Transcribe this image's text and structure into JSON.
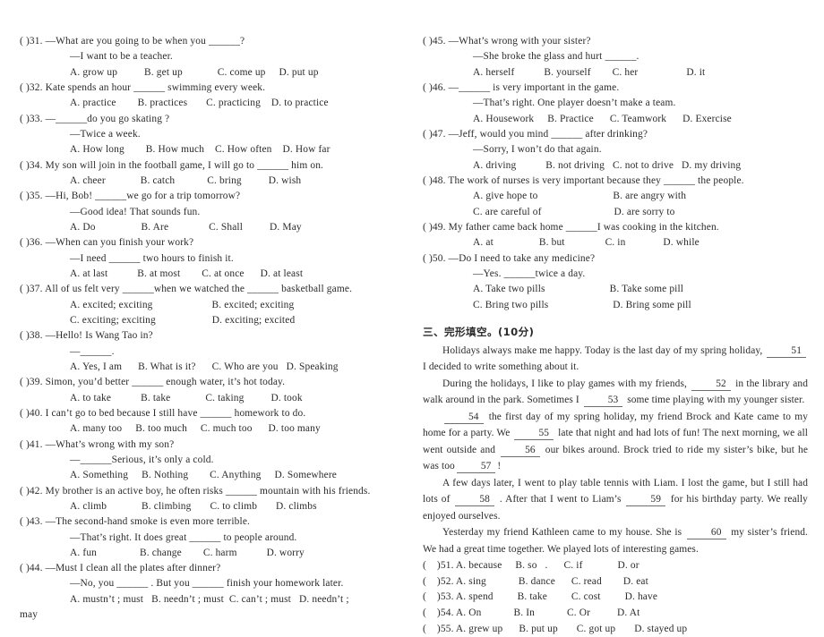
{
  "document": {
    "type": "english-exam-paper",
    "background_color": "#ffffff",
    "text_color": "#2b2b2b"
  },
  "left_column": {
    "questions": [
      {
        "marker": "(    )31.",
        "stem": "—What are you going to be when you ______?",
        "reply": "—I want to be a teacher.",
        "options_lines": [
          "A. grow up          B. get up             C. come up     D. put up"
        ]
      },
      {
        "marker": "(    )32.",
        "stem": "Kate spends an hour ______ swimming every week.",
        "reply": "",
        "options_lines": [
          "A. practice        B. practices       C. practicing    D. to practice"
        ]
      },
      {
        "marker": "(    )33.",
        "stem": "—______do you go skating ?",
        "reply": "—Twice a week.",
        "options_lines": [
          "A. How long        B. How much    C. How often    D. How far"
        ]
      },
      {
        "marker": "(    )34.",
        "stem": "My son will join in the football game, I will go to ______ him  on.",
        "reply": "",
        "options_lines": [
          "A. cheer             B. catch            C. bring          D. wish"
        ]
      },
      {
        "marker": "(    )35.",
        "stem": "—Hi, Bob! ______we go for a trip tomorrow?",
        "reply": "—Good idea! That sounds fun.",
        "options_lines": [
          "A. Do                 B. Are               C. Shall          D. May"
        ]
      },
      {
        "marker": "(    )36.",
        "stem": "—When can you finish your work?",
        "reply": "—I need ______ two hours to finish it.",
        "options_lines": [
          "A. at last           B. at most        C. at once      D. at least"
        ]
      },
      {
        "marker": "(    )37.",
        "stem": "All of us felt very ______when we watched the ______ basketball game.",
        "reply": "",
        "options_lines": [
          "A. excited; exciting                      B. excited; exciting",
          "C. exciting; exciting                     D. exciting; excited"
        ]
      },
      {
        "marker": "(    )38.",
        "stem": "—Hello! Is Wang Tao in?",
        "reply": "—______.",
        "options_lines": [
          "A. Yes, I am      B. What is it?      C. Who are you   D. Speaking"
        ]
      },
      {
        "marker": "(    )39.",
        "stem": "Simon, you’d better ______ enough water, it’s hot today.",
        "reply": "",
        "options_lines": [
          "A. to take           B. take             C. taking          D. took"
        ]
      },
      {
        "marker": "(    )40.",
        "stem": "I can’t go to bed because I still have ______ homework to do.",
        "reply": "",
        "options_lines": [
          "A. many too     B. too much     C. much too      D. too many"
        ]
      },
      {
        "marker": "(    )41.",
        "stem": "—What’s wrong with my son?",
        "reply": "—______Serious, it’s only a cold.",
        "options_lines": [
          "A. Something     B. Nothing        C. Anything     D. Somewhere"
        ]
      },
      {
        "marker": "(    )42.",
        "stem": "My brother is an active boy, he often risks ______ mountain with his friends.",
        "reply": "",
        "options_lines": [
          "A. climb             B. climbing       C. to climb       D. climbs"
        ]
      },
      {
        "marker": "(    )43.",
        "stem": "—The second-hand smoke is even more terrible.",
        "reply": "—That’s right. It does great ______ to people around.",
        "options_lines": [
          "A. fun                B. change        C. harm           D. worry"
        ]
      },
      {
        "marker": "(    )44.",
        "stem": "—Must I clean all the plates after dinner?",
        "reply": "—No, you ______ . But you ______ finish your homework later.",
        "options_lines": [
          "A. mustn’t ; must   B. needn’t ; must  C. can’t ; must   D. needn’t ;"
        ],
        "overflow": "may"
      }
    ]
  },
  "right_column": {
    "questions": [
      {
        "marker": "(    )45.",
        "stem": "—What’s wrong with your sister?",
        "reply": "—She broke the glass and hurt ______.",
        "options_lines": [
          "A. herself           B. yourself        C. her                  D. it"
        ]
      },
      {
        "marker": "(    )46.",
        "stem": "—______ is very important in the game.",
        "reply": "—That’s right. One player doesn’t make a team.",
        "options_lines": [
          "A. Housework     B. Practice      C. Teamwork      D. Exercise"
        ]
      },
      {
        "marker": "(    )47.",
        "stem": "—Jeff, would you mind ______ after drinking?",
        "reply": "—Sorry, I won’t do that again.",
        "options_lines": [
          "A. driving           B. not driving   C. not to drive   D. my driving"
        ]
      },
      {
        "marker": "(    )48.",
        "stem": "The work of nurses is very important because they ______ the people.",
        "reply": "",
        "options_lines": [
          "A. give hope to                            B. are angry with",
          "C. are careful of                           D. are sorry to"
        ]
      },
      {
        "marker": "(    )49.",
        "stem": "My father came back home ______I was cooking in the kitchen.",
        "reply": "",
        "options_lines": [
          "A. at                 B. but               C. in              D. while"
        ]
      },
      {
        "marker": "(    )50.",
        "stem": "—Do I need to take any medicine?",
        "reply": "—Yes. ______twice a day.",
        "options_lines": [
          "A. Take two pills                        B. Take some pill",
          "C. Bring two pills                        D. Bring some pill"
        ]
      }
    ],
    "section": {
      "heading": "三、完形填空。(10分)",
      "paragraphs": [
        {
          "parts": [
            {
              "t": "text",
              "v": "Holidays always make me happy. Today is the last day of my spring holiday, "
            },
            {
              "t": "blank",
              "v": "51"
            },
            {
              "t": "text",
              "v": " I decided to write something about it."
            }
          ]
        },
        {
          "parts": [
            {
              "t": "text",
              "v": "During the holidays, I like to play games with my friends, "
            },
            {
              "t": "blank",
              "v": "52"
            },
            {
              "t": "text",
              "v": " in the library and walk around in the park. Sometimes I "
            },
            {
              "t": "blank",
              "v": "53"
            },
            {
              "t": "text",
              "v": " some time playing with my younger sister."
            }
          ]
        },
        {
          "parts": [
            {
              "t": "blank",
              "v": "54"
            },
            {
              "t": "text",
              "v": " the first day of my spring holiday, my friend Brock and Kate came to my home for a party. We "
            },
            {
              "t": "blank",
              "v": "55"
            },
            {
              "t": "text",
              "v": " late that night and had lots of fun! The next morning, we all went outside and "
            },
            {
              "t": "blank",
              "v": "56"
            },
            {
              "t": "text",
              "v": " our bikes around. Brock tried to ride my sister’s bike, but he was too"
            },
            {
              "t": "blank",
              "v": "57"
            },
            {
              "t": "text",
              "v": "!"
            }
          ]
        },
        {
          "parts": [
            {
              "t": "text",
              "v": "A few days later, I went to play table tennis with Liam. I lost the game, but I still had lots of "
            },
            {
              "t": "blank",
              "v": "58"
            },
            {
              "t": "text",
              "v": " . After that I went to Liam’s "
            },
            {
              "t": "blank",
              "v": "59"
            },
            {
              "t": "text",
              "v": " for his birthday party. We really enjoyed ourselves."
            }
          ]
        },
        {
          "parts": [
            {
              "t": "text",
              "v": "Yesterday my friend Kathleen came to my house. She is "
            },
            {
              "t": "blank",
              "v": "60"
            },
            {
              "t": "text",
              "v": " my sister’s friend. We had a great time together. We played lots of interesting games."
            }
          ]
        }
      ],
      "cloze_options": [
        "(    )51. A. because     B. so   .      C. if             D. or",
        "(    )52. A. sing            B. dance      C. read        D. eat",
        "(    )53. A. spend         B. take         C. cost         D. have",
        "(    )54. A. On            B. In            C. Or          D. At",
        "(    )55. A. grew up      B. put up       C. got up       D. stayed up"
      ]
    }
  }
}
